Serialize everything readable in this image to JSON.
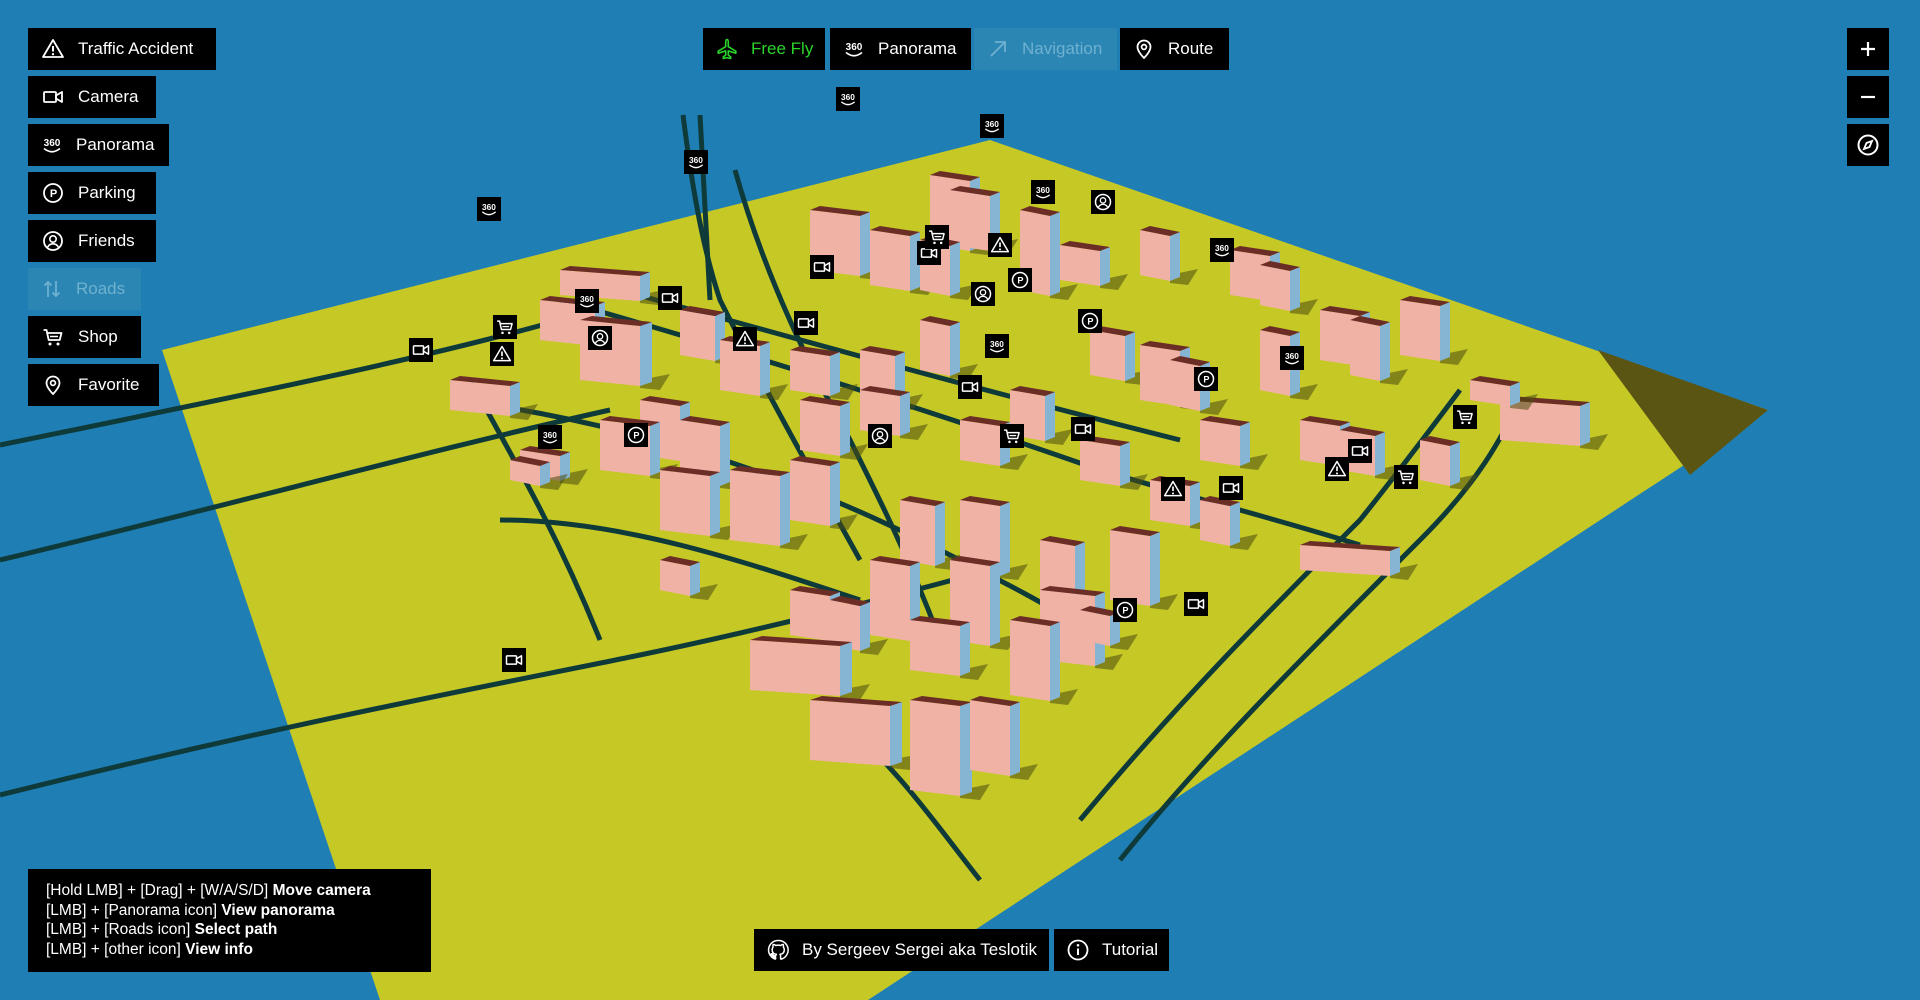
{
  "left_menu": [
    {
      "label": "Traffic Accident",
      "icon": "warning-triangle-icon",
      "enabled": true
    },
    {
      "label": "Camera",
      "icon": "video-camera-icon",
      "enabled": true
    },
    {
      "label": "Panorama",
      "icon": "panorama-360-icon",
      "enabled": true
    },
    {
      "label": "Parking",
      "icon": "parking-icon",
      "enabled": true
    },
    {
      "label": "Friends",
      "icon": "user-circle-icon",
      "enabled": true
    },
    {
      "label": "Roads",
      "icon": "up-down-arrows-icon",
      "enabled": false
    },
    {
      "label": "Shop",
      "icon": "shopping-cart-icon",
      "enabled": true
    },
    {
      "label": "Favorite",
      "icon": "map-pin-icon",
      "enabled": true
    }
  ],
  "top_modes": [
    {
      "label": "Free Fly",
      "icon": "airplane-icon",
      "state": "active"
    },
    {
      "label": "Panorama",
      "icon": "panorama-360-icon",
      "state": "normal"
    },
    {
      "label": "Navigation",
      "icon": "arrow-up-right-icon",
      "state": "disabled"
    },
    {
      "label": "Route",
      "icon": "map-pin-icon",
      "state": "normal"
    }
  ],
  "zoom": {
    "in_icon": "plus-icon",
    "out_icon": "minus-icon",
    "compass_icon": "compass-icon"
  },
  "help": [
    {
      "keys": "[Hold LMB] + [Drag] + [W/A/S/D]",
      "action": "Move camera"
    },
    {
      "keys": "[LMB] + [Panorama icon]",
      "action": "View panorama"
    },
    {
      "keys": "[LMB] + [Roads icon]",
      "action": "Select path"
    },
    {
      "keys": "[LMB] + [other icon]",
      "action": "View info"
    }
  ],
  "footer": {
    "author_label": "By Sergeev Sergei aka Teslotik",
    "author_icon": "github-icon",
    "tutorial_label": "Tutorial",
    "tutorial_icon": "info-circle-icon"
  },
  "map_markers": {
    "panorama_label": "360",
    "parking_label": "P"
  },
  "colors": {
    "water": "#1f7fb5",
    "ground": "#c6c826",
    "road": "#0f3a3a",
    "building_front": "#f1b2a6",
    "building_side": "#86b4d3",
    "building_roof": "#6b2e26",
    "active_green": "#2bd42b",
    "panel_bg": "#000000"
  }
}
